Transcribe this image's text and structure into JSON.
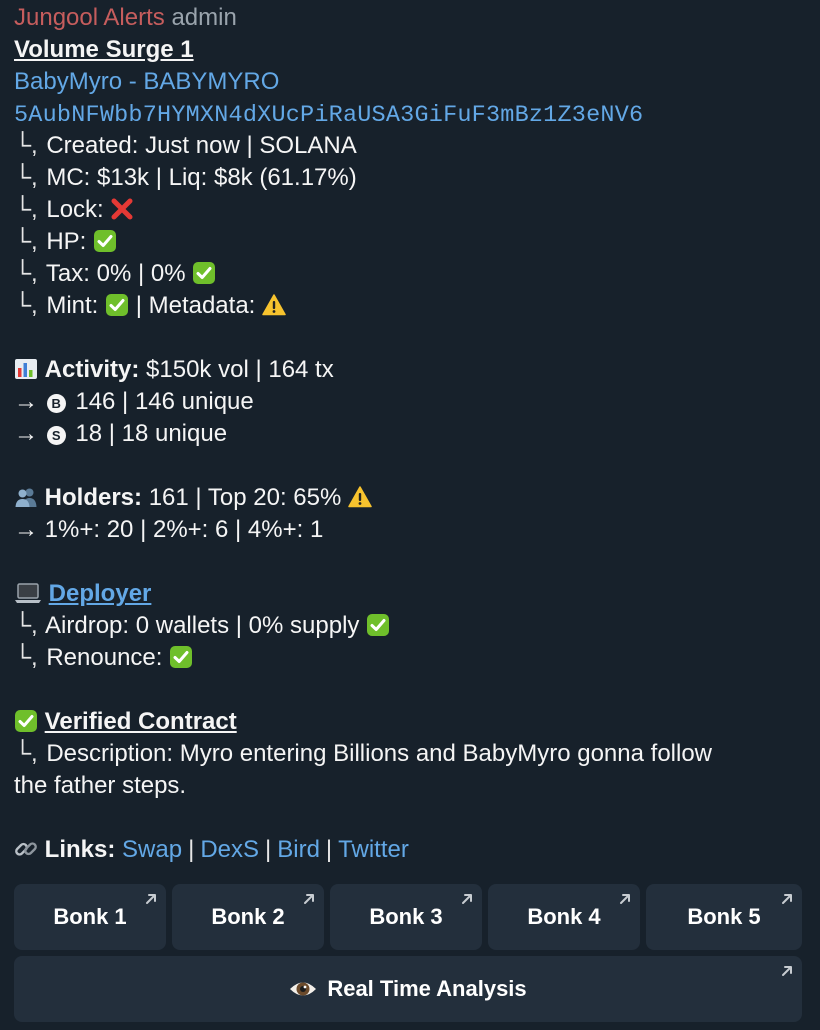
{
  "header": {
    "sender": "Jungool Alerts",
    "role": "admin"
  },
  "message": {
    "title": "Volume Surge 1",
    "token_name": "BabyMyro - BABYMYRO",
    "address": "5AubNFWbb7HYMXN4dXUcPiRaUSA3GiFuF3mBz1Z3eNV6",
    "tree_prefix": "└,",
    "created": "Created: Just now | SOLANA",
    "mc": "MC: $13k | Liq: $8k (61.17%)",
    "lock_label": "Lock:",
    "hp_label": "HP:",
    "tax_label": "Tax: 0% | 0%",
    "mint_label": "Mint:",
    "metadata_label": "| Metadata:",
    "activity_label": "Activity:",
    "activity_value": "$150k vol | 164 tx",
    "arrow": "→",
    "buy_letter": "B",
    "buy_value": "146 | 146 unique",
    "sell_letter": "S",
    "sell_value": "18 | 18 unique",
    "holders_label": "Holders:",
    "holders_value": "161 | Top 20: 65%",
    "holders_dist": "1%+: 20 | 2%+: 6 | 4%+: 1",
    "deployer_label": "Deployer",
    "airdrop": "Airdrop: 0 wallets | 0% supply",
    "renounce": "Renounce:",
    "verified_label": "Verified Contract",
    "description_line1": "Description: Myro entering Billions and BabyMyro gonna follow",
    "description_line2": "the father steps.",
    "links_label": "Links:",
    "links": [
      "Swap",
      "DexS",
      "Bird",
      "Twitter"
    ],
    "link_sep": "|"
  },
  "buttons": {
    "row1": [
      "Bonk 1",
      "Bonk 2",
      "Bonk 3",
      "Bonk 4",
      "Bonk 5"
    ],
    "analysis": "Real Time Analysis"
  },
  "icons": {
    "check": "check-mark-icon",
    "cross": "cross-mark-icon",
    "warning": "warning-icon",
    "chart": "bar-chart-icon",
    "holders": "people-icon",
    "laptop": "laptop-icon",
    "link": "chain-link-icon",
    "eye": "eye-icon",
    "external": "open-external-icon"
  },
  "colors": {
    "background": "#17212b",
    "sender": "#c65d5d",
    "link": "#63a8e6",
    "button_bg": "#232f3c",
    "check_green": "#6fbf2b",
    "cross_red": "#e53935",
    "warning_yellow": "#f7c32e"
  }
}
